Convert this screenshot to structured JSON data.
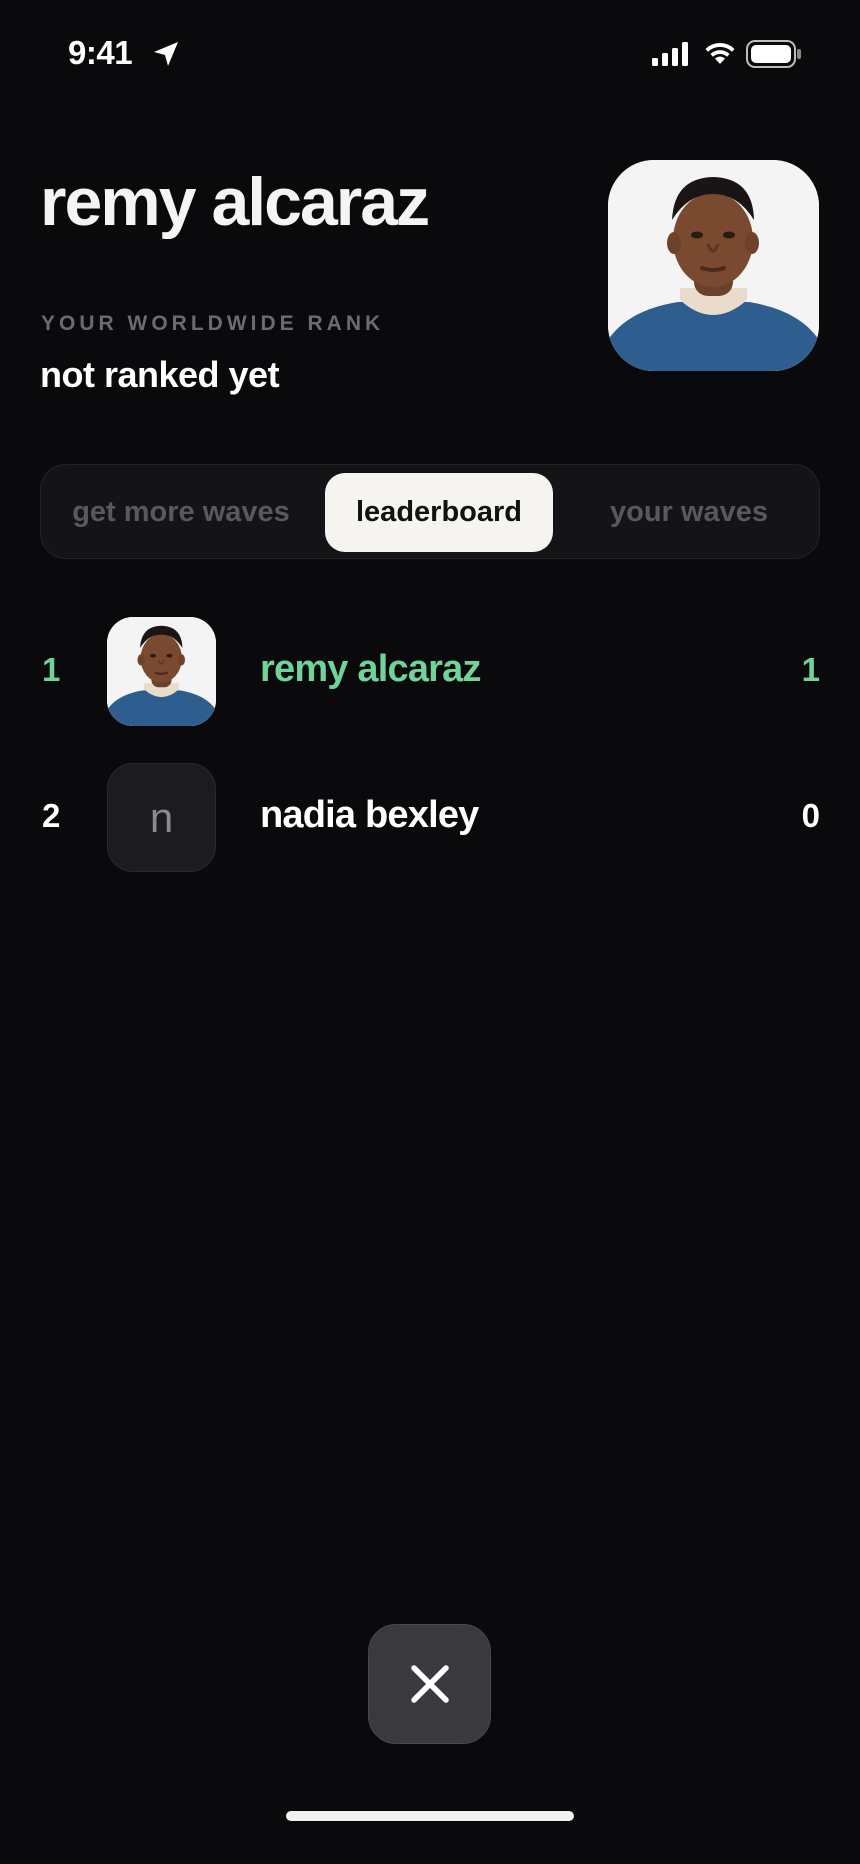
{
  "status_bar": {
    "time": "9:41",
    "icons": [
      "location-arrow-icon",
      "cellular-signal-icon",
      "wifi-icon",
      "battery-icon"
    ]
  },
  "profile": {
    "name": "remy alcaraz",
    "rank_caption": "YOUR WORLDWIDE RANK",
    "rank_value": "not ranked yet"
  },
  "tabs": [
    {
      "label": "get more waves",
      "selected": false
    },
    {
      "label": "leaderboard",
      "selected": true
    },
    {
      "label": "your waves",
      "selected": false
    }
  ],
  "leaderboard": [
    {
      "rank": "1",
      "name": "remy alcaraz",
      "score": "1",
      "avatar": "photo",
      "is_current_user": true
    },
    {
      "rank": "2",
      "name": "nadia bexley",
      "score": "0",
      "avatar_initial": "n",
      "is_current_user": false
    }
  ],
  "colors": {
    "background": "#0a0a0c",
    "highlight": "#6fd39a",
    "selected_tab_bg": "#f6f4f0",
    "close_button_bg": "#3a3a3e"
  },
  "close_button": {
    "icon": "close-icon"
  }
}
